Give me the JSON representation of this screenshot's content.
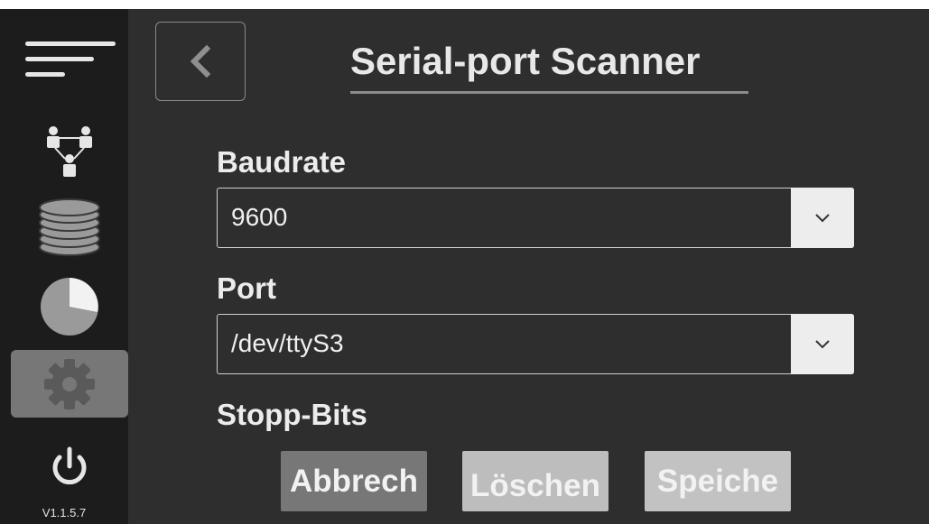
{
  "sidebar": {
    "menu_icon": "hamburger-menu-icon",
    "items": [
      {
        "icon": "users-network-icon",
        "active": false
      },
      {
        "icon": "database-icon",
        "active": false
      },
      {
        "icon": "pie-chart-icon",
        "active": false
      },
      {
        "icon": "gear-icon",
        "active": true
      },
      {
        "icon": "power-icon",
        "active": false
      }
    ],
    "version": "V1.1.5.7"
  },
  "header": {
    "back_icon": "chevron-left-icon",
    "title": "Serial-port Scanner"
  },
  "form": {
    "baudrate": {
      "label": "Baudrate",
      "value": "9600",
      "toggle_icon": "chevron-down-icon"
    },
    "port": {
      "label": "Port",
      "value": "/dev/ttyS3",
      "toggle_icon": "chevron-down-icon"
    },
    "stopbits": {
      "label": "Stopp-Bits"
    }
  },
  "actions": {
    "cancel_label": "Abbrech",
    "delete_label": "Löschen",
    "save_label": "Speiche"
  },
  "colors": {
    "background": "#2e2e2e",
    "sidebar": "#1c1c1c",
    "active_item": "#777777",
    "text": "#e8e8e8"
  }
}
